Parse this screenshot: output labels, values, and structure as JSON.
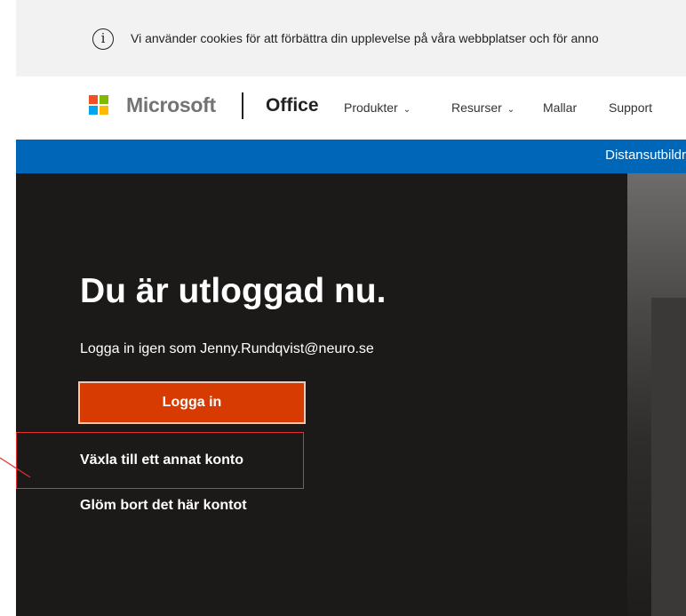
{
  "cookie_banner": {
    "icon": "info-icon",
    "text": "Vi använder cookies för att förbättra din upplevelse på våra webbplatser och för anno"
  },
  "header": {
    "brand": "Microsoft",
    "product": "Office",
    "nav": [
      {
        "label": "Produkter",
        "icon": "chevron-down-icon"
      },
      {
        "label": "Resurser",
        "icon": "chevron-down-icon"
      },
      {
        "label": "Mallar"
      },
      {
        "label": "Support"
      }
    ],
    "logo_colors": [
      "#f25022",
      "#7fba00",
      "#00a4ef",
      "#ffb900"
    ]
  },
  "banner": {
    "text": "Distansutbildr",
    "color": "#0067b8"
  },
  "hero": {
    "heading": "Du är utloggad nu.",
    "subtitle": "Logga in igen som Jenny.Rundqvist@neuro.se",
    "signin_button": "Logga in",
    "switch_account": "Växla till ett annat konto",
    "forget_account": "Glöm bort det här kontot",
    "button_color": "#d83b01",
    "highlight_color": "#e53030"
  }
}
